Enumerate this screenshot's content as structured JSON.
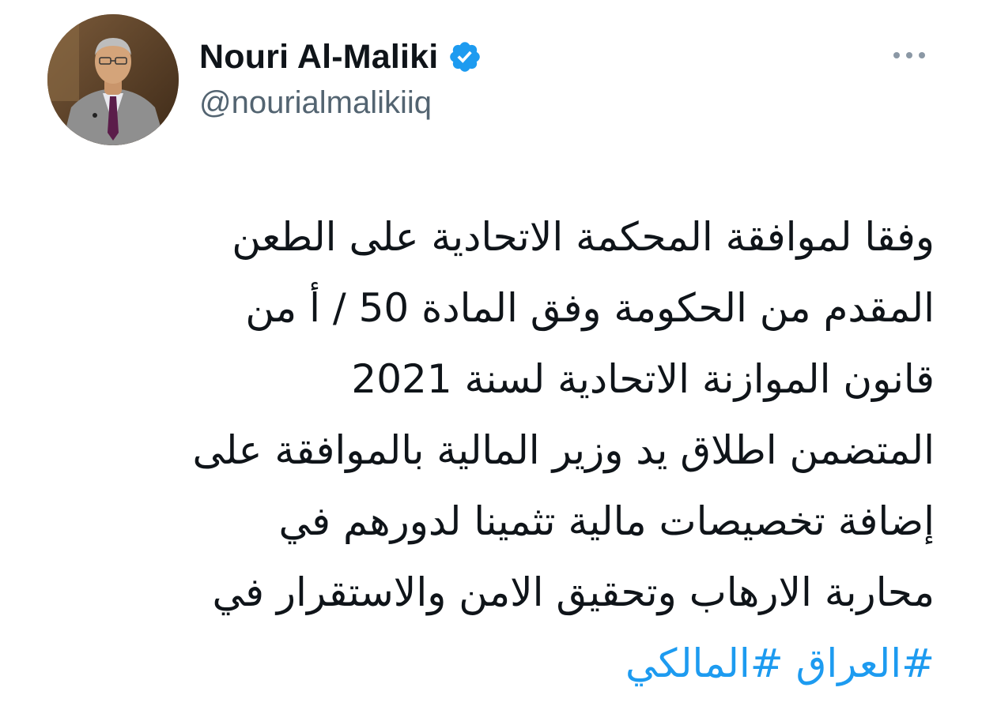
{
  "tweet": {
    "author": {
      "display_name": "Nouri Al-Maliki",
      "handle": "@nourialmalikiiq",
      "verified": true,
      "verified_icon": "verified-badge-icon",
      "accent_color": "#1d9bf0"
    },
    "more_icon": "more-horizontal-icon",
    "body_lines": [
      "وفقا لموافقة المحكمة الاتحادية على الطعن",
      "المقدم من الحكومة وفق المادة 50 / أ من",
      "قانون الموازنة الاتحادية لسنة 2021",
      "المتضمن اطلاق يد وزير المالية بالموافقة على",
      "إضافة تخصيصات مالية تثمينا لدورهم في",
      "محاربة الارهاب وتحقيق الامن والاستقرار في"
    ],
    "hashtags": [
      "#العراق",
      "#المالكي"
    ],
    "hashtag_color": "#1d9bf0",
    "text_color": "#0f1419",
    "handle_color": "#536471"
  }
}
